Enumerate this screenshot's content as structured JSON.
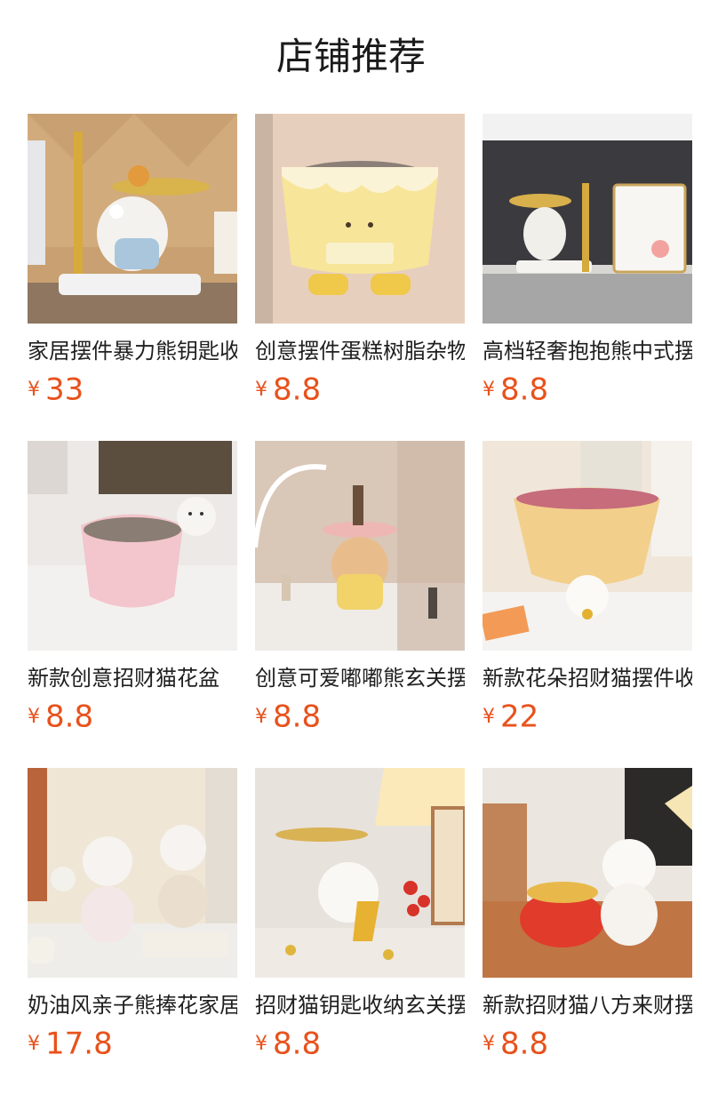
{
  "page_title": "店铺推荐",
  "currency_symbol": "¥",
  "colors": {
    "price": "#e8521c",
    "text": "#1f1f1f"
  },
  "products": [
    {
      "name": "家居摆件暴力熊钥匙收纳托盘",
      "price": "33"
    },
    {
      "name": "创意摆件蛋糕树脂杂物收纳",
      "price": "8.8"
    },
    {
      "name": "高档轻奢抱抱熊中式摆件",
      "price": "8.8"
    },
    {
      "name": "新款创意招财猫花盆",
      "price": "8.8"
    },
    {
      "name": "创意可爱嘟嘟熊玄关摆件",
      "price": "8.8"
    },
    {
      "name": "新款花朵招财猫摆件收纳",
      "price": "22"
    },
    {
      "name": "奶油风亲子熊捧花家居摆件",
      "price": "17.8"
    },
    {
      "name": "招财猫钥匙收纳玄关摆件",
      "price": "8.8"
    },
    {
      "name": "新款招财猫八方来财摆件",
      "price": "8.8"
    }
  ]
}
